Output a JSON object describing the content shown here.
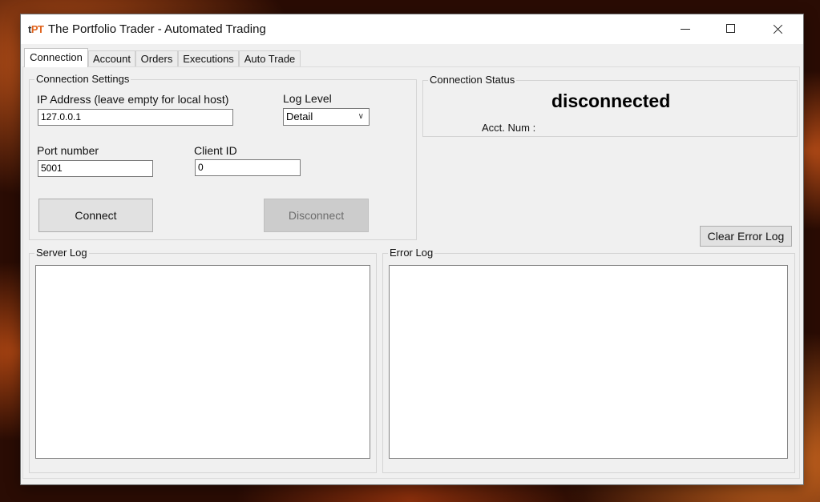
{
  "window": {
    "logo_t": "t",
    "logo_pt": "PT",
    "title": "The Portfolio Trader - Automated Trading",
    "controls": {
      "minimize": "minimize-icon",
      "maximize": "maximize-icon",
      "close": "close-icon"
    }
  },
  "tabs": [
    {
      "label": "Connection",
      "active": true
    },
    {
      "label": "Account",
      "active": false
    },
    {
      "label": "Orders",
      "active": false
    },
    {
      "label": "Executions",
      "active": false
    },
    {
      "label": "Auto Trade",
      "active": false
    }
  ],
  "connection_settings": {
    "title": "Connection Settings",
    "ip_label": "IP Address (leave empty for local host)",
    "ip_value": "127.0.0.1",
    "log_level_label": "Log Level",
    "log_level_value": "Detail",
    "port_label": "Port number",
    "port_value": "5001",
    "client_id_label": "Client ID",
    "client_id_value": "0",
    "connect_label": "Connect",
    "disconnect_label": "Disconnect"
  },
  "connection_status": {
    "title": "Connection Status",
    "state": "disconnected",
    "acct_label": "Acct. Num :",
    "acct_value": ""
  },
  "clear_error_log_label": "Clear Error Log",
  "server_log": {
    "title": "Server Log",
    "content": ""
  },
  "error_log": {
    "title": "Error Log",
    "content": ""
  },
  "colors": {
    "logo_accent": "#e0621b",
    "window_bg": "#f0f0f0",
    "disabled_button": "#cccccc"
  }
}
